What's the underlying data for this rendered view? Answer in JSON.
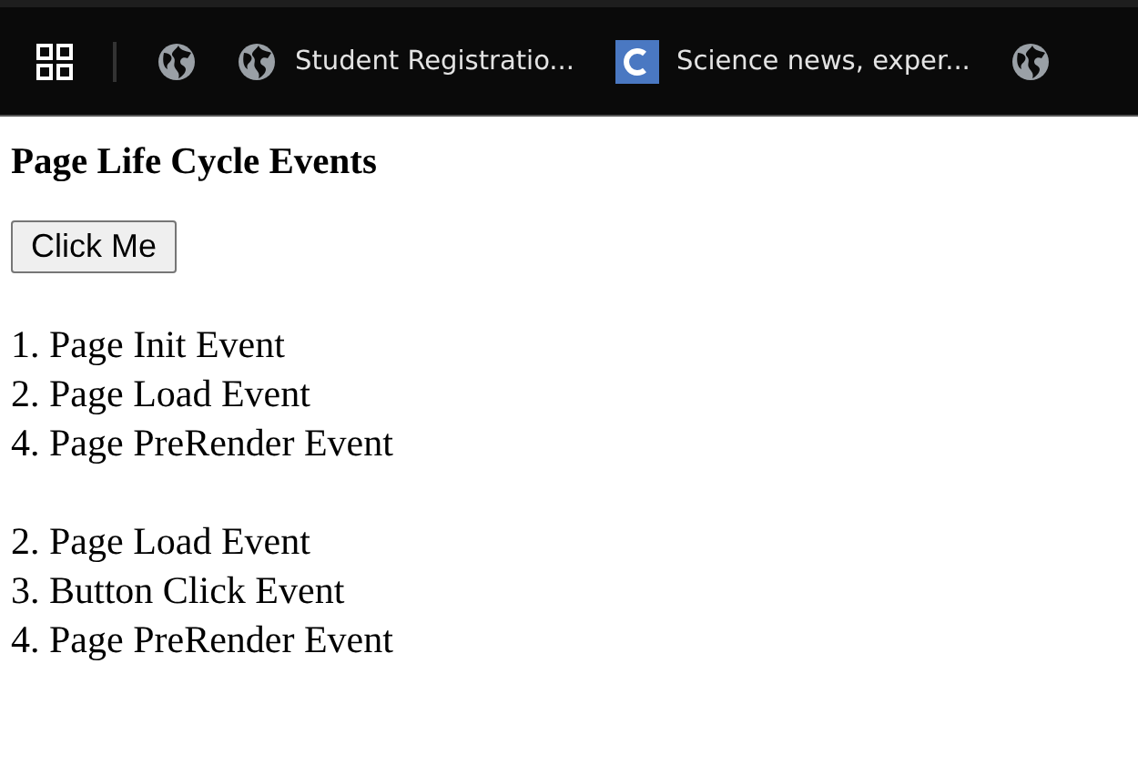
{
  "bookmarks_bar": [
    {
      "kind": "apps"
    },
    {
      "kind": "globe"
    },
    {
      "kind": "globe",
      "label": "Student Registratio..."
    },
    {
      "kind": "c-logo",
      "label": "Science news, exper..."
    },
    {
      "kind": "globe"
    }
  ],
  "page": {
    "heading": "Page Life Cycle Events",
    "button": "Click Me",
    "event_groups": [
      [
        "1. Page Init Event",
        "2. Page Load Event",
        "4. Page PreRender Event"
      ],
      [
        "2. Page Load Event",
        "3. Button Click Event",
        "4. Page PreRender Event"
      ]
    ]
  }
}
